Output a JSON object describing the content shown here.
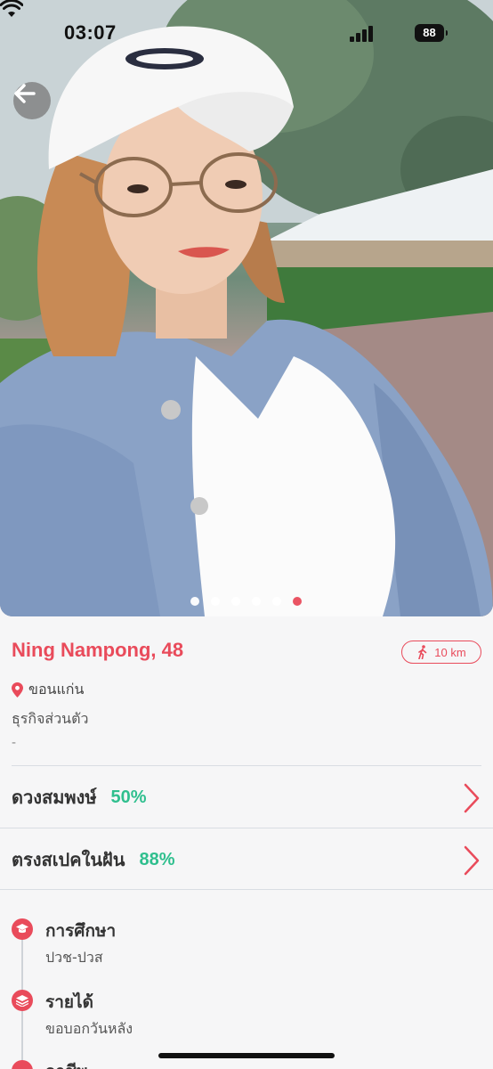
{
  "status_bar": {
    "time": "03:07",
    "battery": "88"
  },
  "photo": {
    "page_count": 6,
    "active_index": 5
  },
  "profile": {
    "name_age": "Ning Nampong, 48",
    "distance": "10 km",
    "location": "ขอนแก่น",
    "occupation": "ธุรกิจส่วนตัว",
    "bio": "-"
  },
  "compatibility": [
    {
      "label": "ดวงสมพงษ์",
      "value": "50%"
    },
    {
      "label": "ตรงสเปคในฝัน",
      "value": "88%"
    }
  ],
  "details": [
    {
      "title": "การศึกษา",
      "value": "ปวช-ปวส",
      "icon": "graduation-cap-icon"
    },
    {
      "title": "รายได้",
      "value": "ขอบอกวันหลัง",
      "icon": "stack-icon"
    },
    {
      "title": "อาชีพ",
      "value": "",
      "icon": "info-icon"
    }
  ],
  "colors": {
    "accent": "#e94b5b",
    "match_green": "#2fbf8e",
    "background": "#f6f6f7"
  }
}
